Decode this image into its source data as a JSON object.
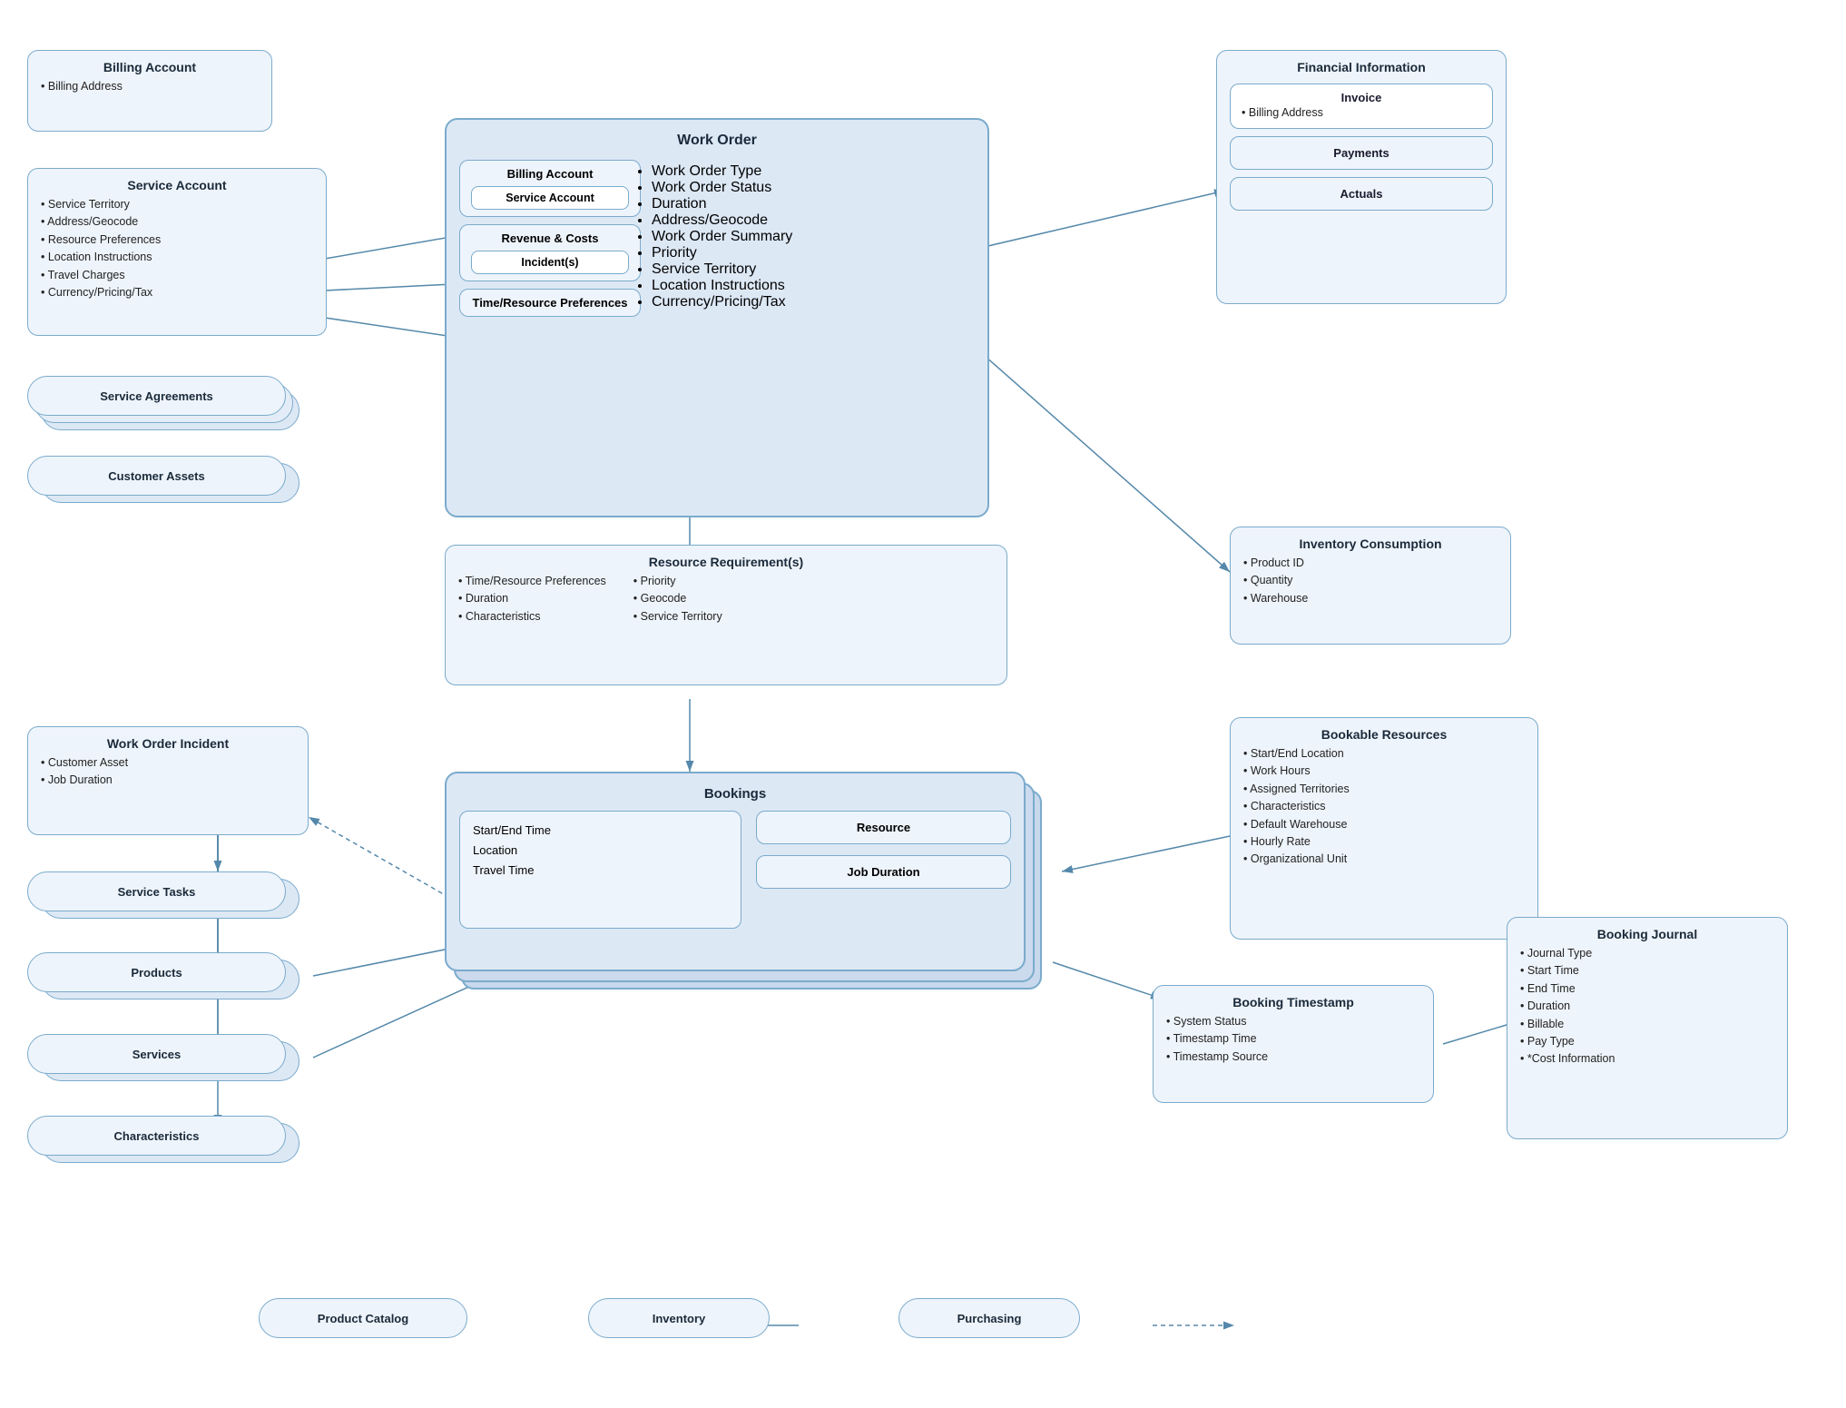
{
  "billing_account_top": {
    "title": "Billing Account",
    "items": [
      "Billing Address"
    ]
  },
  "service_account": {
    "title": "Service Account",
    "items": [
      "Service Territory",
      "Address/Geocode",
      "Resource Preferences",
      "Location Instructions",
      "Travel Charges",
      "Currency/Pricing/Tax"
    ]
  },
  "service_agreements": "Service Agreements",
  "customer_assets": "Customer Assets",
  "work_order_incident": {
    "title": "Work Order Incident",
    "items": [
      "Customer Asset",
      "Job Duration"
    ]
  },
  "service_tasks": "Service Tasks",
  "products": "Products",
  "services": "Services",
  "characteristics_left": "Characteristics",
  "product_catalog": "Product Catalog",
  "inventory": "Inventory",
  "purchasing": "Purchasing",
  "work_order_main": {
    "title": "Work Order",
    "billing_account_label": "Billing Account",
    "service_account_label": "Service Account",
    "revenue_costs_label": "Revenue & Costs",
    "incidents_label": "Incident(s)",
    "time_resource_label": "Time/Resource Preferences",
    "items": [
      "Work Order Type",
      "Work Order Status",
      "Duration",
      "Address/Geocode",
      "Work Order Summary",
      "Priority",
      "Service Territory",
      "Location Instructions",
      "Currency/Pricing/Tax"
    ]
  },
  "financial_information": {
    "title": "Financial Information",
    "invoice_label": "Invoice",
    "invoice_item": "Billing Address",
    "payments_label": "Payments",
    "actuals_label": "Actuals"
  },
  "inventory_consumption": {
    "title": "Inventory Consumption",
    "items": [
      "Product ID",
      "Quantity",
      "Warehouse"
    ]
  },
  "resource_requirements": {
    "title": "Resource Requirement(s)",
    "items_left": [
      "Time/Resource Preferences",
      "Duration",
      "Characteristics"
    ],
    "items_right": [
      "Priority",
      "Geocode",
      "Service Territory"
    ]
  },
  "bookings": {
    "title": "Bookings",
    "left_items": [
      "Start/End Time",
      "Location",
      "Travel Time"
    ],
    "resource_label": "Resource",
    "job_duration_label": "Job Duration"
  },
  "bookable_resources": {
    "title": "Bookable Resources",
    "items": [
      "Start/End Location",
      "Work Hours",
      "Assigned Territories",
      "Characteristics",
      "Default Warehouse",
      "Hourly Rate",
      "Organizational Unit"
    ]
  },
  "booking_timestamp": {
    "title": "Booking Timestamp",
    "items": [
      "System Status",
      "Timestamp Time",
      "Timestamp Source"
    ]
  },
  "booking_journal": {
    "title": "Booking Journal",
    "items": [
      "Journal Type",
      "Start Time",
      "End Time",
      "Duration",
      "Billable",
      "Pay Type",
      "*Cost Information"
    ]
  }
}
